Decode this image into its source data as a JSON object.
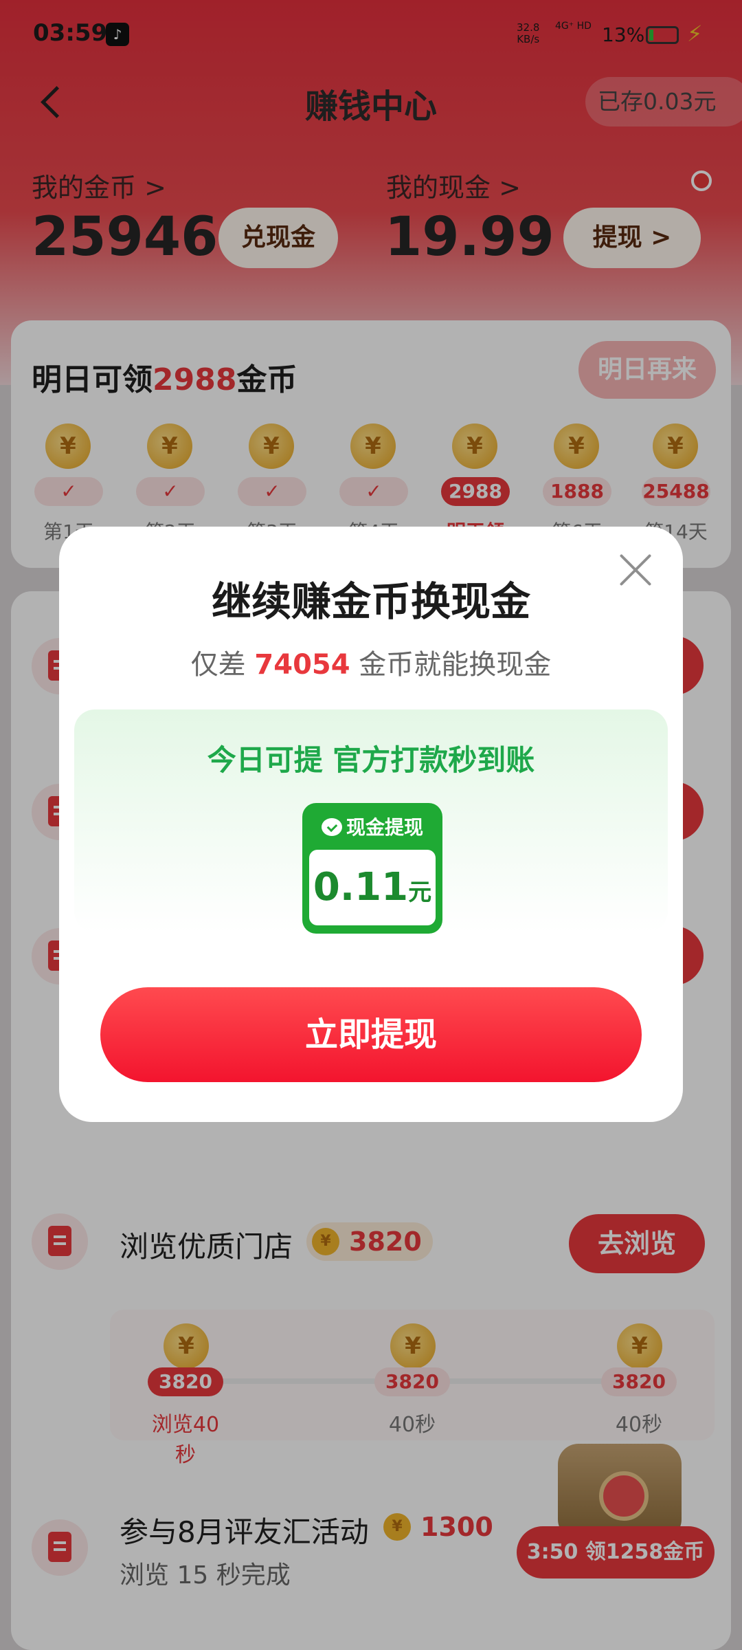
{
  "status_bar": {
    "time": "03:59",
    "net_speed": "32.8",
    "net_speed_unit": "KB/s",
    "network": "4G⁺ HD",
    "battery": "13%"
  },
  "header": {
    "title": "赚钱中心",
    "saved_label": "已存0.03元",
    "coins_label": "我的金币 >",
    "coins_value": "25946",
    "exchange_button": "兑现金",
    "cash_label": "我的现金 >",
    "cash_value": "19.99",
    "withdraw_button": "提现 >"
  },
  "checkin": {
    "title_prefix": "明日可领",
    "title_highlight": "2988",
    "title_suffix": "金币",
    "button": "明日再来",
    "days": [
      {
        "tag": "✓",
        "label": "第1天"
      },
      {
        "tag": "✓",
        "label": "第2天"
      },
      {
        "tag": "✓",
        "label": "第3天"
      },
      {
        "tag": "✓",
        "label": "第4天"
      },
      {
        "tag": "2988",
        "label": "明天领"
      },
      {
        "tag": "1888",
        "label": "第6天"
      },
      {
        "tag": "25488",
        "label": "第14天"
      }
    ]
  },
  "tasks": {
    "browse_store": {
      "title": "浏览优质门店",
      "coins": "3820",
      "button": "去浏览",
      "steps": [
        {
          "tag": "3820",
          "label": "浏览40秒"
        },
        {
          "tag": "3820",
          "label": "40秒"
        },
        {
          "tag": "3820",
          "label": "40秒"
        }
      ]
    },
    "august_event": {
      "title": "参与8月评友汇活动",
      "coins": "1300",
      "subtitle": "浏览 15 秒完成"
    },
    "timer_button": "3:50 领1258金币"
  },
  "modal": {
    "title": "继续赚金币换现金",
    "sub_prefix": "仅差 ",
    "sub_number": "74054",
    "sub_suffix": " 金币就能换现金",
    "panel_heading": "今日可提 官方打款秒到账",
    "cash_card_label": "现金提现",
    "cash_amount": "0.11",
    "cash_unit": "元",
    "cta": "立即提现"
  },
  "colors": {
    "brand_red": "#e8383d",
    "wechat_green": "#1faa34"
  }
}
